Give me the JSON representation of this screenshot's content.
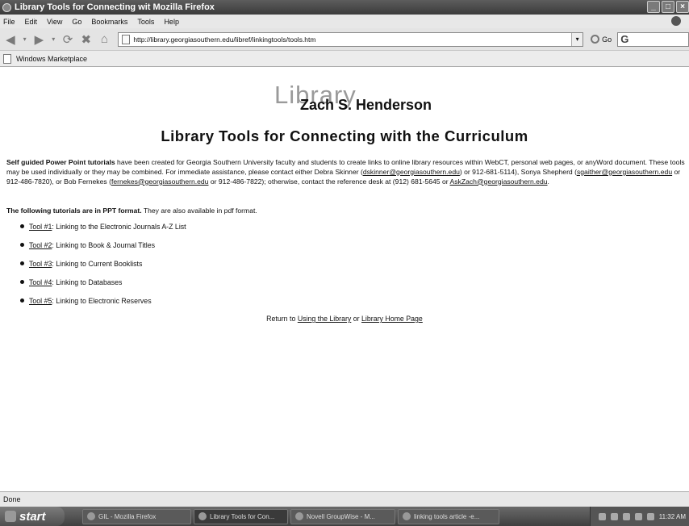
{
  "window": {
    "title": "Library Tools for Connecting wit   Mozilla Firefox",
    "buttons": [
      "_",
      "□",
      "×"
    ]
  },
  "menu": [
    "File",
    "Edit",
    "View",
    "Go",
    "Bookmarks",
    "Tools",
    "Help"
  ],
  "toolbar": {
    "url": "http://library.georgiasouthern.edu/libref/linkingtools/tools.htm",
    "go_label": "Go",
    "search_value": "G"
  },
  "bookmarks": [
    "Windows Marketplace"
  ],
  "page": {
    "logo_word": "Library",
    "logo_name": "Zach S. Henderson",
    "heading": "Library Tools for Connecting with the Curriculum",
    "intro": {
      "bold_lead": "Self guided Power Point tutorials",
      "text1": " have been created for Georgia Southern University faculty and students to create links to online library resources within WebCT, personal web pages, or anyWord document. These tools may be used individually or they may be combined. For immediate assistance, please contact either Debra Skinner (",
      "email1": "dskinner@georgiasouthern.edu",
      "text2": ") or 912-681-5114), Sonya Shepherd (",
      "email2": "sgaither@georgiasouthern.edu",
      "text3": " or 912-486-7820), or Bob Fernekes (",
      "email3": "fernekes@georgiasouthern.edu",
      "text4": " or 912-486-7822); otherwise, contact the reference desk at (912) 681-5645 or ",
      "email4": "AskZach@georgiasouthern.edu",
      "text5": "."
    },
    "formats": {
      "bold": "The following tutorials are in PPT format.",
      "text": " They are also available in ",
      "pdf_link": "pdf",
      "end": " format."
    },
    "tools": [
      {
        "link": "Tool #1",
        "desc": ": Linking to the Electronic Journals A-Z List"
      },
      {
        "link": "Tool #2",
        "desc": ": Linking to Book & Journal Titles"
      },
      {
        "link": "Tool #3",
        "desc": ": Linking to Current Booklists"
      },
      {
        "link": "Tool #4",
        "desc": ": Linking to Databases"
      },
      {
        "link": "Tool #5",
        "desc": ": Linking to Electronic Reserves"
      }
    ],
    "return": {
      "prefix": "Return to ",
      "link1": "Using the Library",
      "mid": " or ",
      "link2": "Library Home Page"
    }
  },
  "status": "Done",
  "taskbar": {
    "start": "start",
    "tasks": [
      "GIL - Mozilla Firefox",
      "Library Tools for Con...",
      "Novell GroupWise - M...",
      "linking tools article -e..."
    ],
    "clock": "11:32 AM"
  }
}
